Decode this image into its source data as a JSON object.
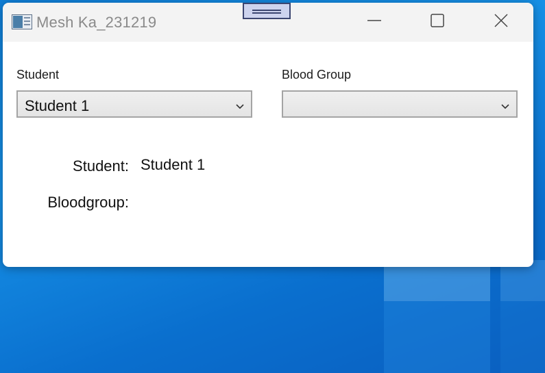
{
  "window": {
    "title": "Mesh Ka_231219",
    "icon": "app-window-icon"
  },
  "caption": {
    "minimize_icon": "minimize-icon",
    "maximize_icon": "maximize-icon",
    "close_icon": "close-icon"
  },
  "form": {
    "student_label": "Student",
    "student_selected": "Student 1",
    "bloodgroup_label": "Blood Group",
    "bloodgroup_selected": ""
  },
  "details": {
    "student_label": "Student:",
    "student_value": "Student 1",
    "bloodgroup_label": "Bloodgroup:",
    "bloodgroup_value": ""
  },
  "colors": {
    "desktop": "#1690e6",
    "titlebar": "#f3f3f3",
    "combo_border": "#a4a4a4"
  }
}
